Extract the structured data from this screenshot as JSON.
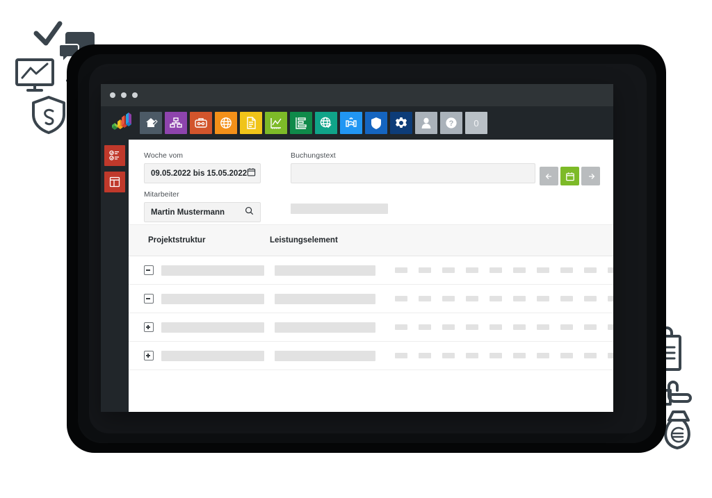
{
  "window": {
    "titlebar": {
      "dots": 3
    },
    "logo_name": "app-logo-colorful-bars"
  },
  "toolbar": {
    "tiles": [
      {
        "name": "home-icon",
        "label": "Home",
        "color": "#4c5a66"
      },
      {
        "name": "org-structure-icon",
        "label": "Organisation",
        "color": "#8e44ad"
      },
      {
        "name": "briefcase-icon",
        "label": "Projekte",
        "color": "#d2552c"
      },
      {
        "name": "globe-icon",
        "label": "Web",
        "color": "#f39019"
      },
      {
        "name": "document-icon",
        "label": "Dokumente",
        "color": "#f0c419"
      },
      {
        "name": "line-chart-icon",
        "label": "Auswertung",
        "color": "#7dba28"
      },
      {
        "name": "gantt-chart-icon",
        "label": "Planung",
        "color": "#0f8a4a"
      },
      {
        "name": "globe-check-icon",
        "label": "Portal",
        "color": "#10a489"
      },
      {
        "name": "handshake-icon",
        "label": "Service",
        "color": "#2196f3"
      },
      {
        "name": "shield-icon",
        "label": "Sicherheit",
        "color": "#1565c0"
      },
      {
        "name": "gear-icon",
        "label": "Einstellungen",
        "color": "#0d3c78"
      },
      {
        "name": "user-icon",
        "label": "Benutzer",
        "color": "#aab2ba"
      },
      {
        "name": "help-icon",
        "label": "Hilfe",
        "color": "#aab2ba"
      },
      {
        "name": "notification-count",
        "label": "0",
        "color": "#b9c0c6"
      }
    ]
  },
  "sidebar": {
    "items": [
      {
        "name": "sidebar-item-tasklist",
        "label": "Aufgabenliste",
        "color": "#c0392b"
      },
      {
        "name": "sidebar-item-layout",
        "label": "Ansicht",
        "color": "#c0392b"
      }
    ]
  },
  "form": {
    "week": {
      "label": "Woche vom",
      "value": "09.05.2022 bis 15.05.2022",
      "icon": "calendar-icon"
    },
    "employee": {
      "label": "Mitarbeiter",
      "value": "Martin Mustermann",
      "icon": "search-icon"
    },
    "booking_text": {
      "label": "Buchungstext",
      "value": "",
      "placeholder": ""
    },
    "nav_buttons": [
      {
        "name": "previous-week-button",
        "icon": "arrow-left-icon",
        "color": "#b9bcbe"
      },
      {
        "name": "today-button",
        "icon": "calendar-icon",
        "color": "#7dba28"
      },
      {
        "name": "next-week-button",
        "icon": "arrow-right-icon",
        "color": "#b9bcbe"
      }
    ]
  },
  "table": {
    "columns": [
      {
        "name": "column-projektstruktur",
        "label": "Projektstruktur"
      },
      {
        "name": "column-leistungselement",
        "label": "Leistungselement"
      }
    ],
    "day_cells_per_row": 10,
    "rows": [
      {
        "expander": "minus",
        "state": "expanded"
      },
      {
        "expander": "minus",
        "state": "expanded"
      },
      {
        "expander": "plus",
        "state": "collapsed"
      },
      {
        "expander": "plus",
        "state": "collapsed"
      }
    ]
  },
  "decorations": {
    "icons": [
      "checkmark-icon",
      "chat-bubbles-icon",
      "monitor-chart-icon",
      "factory-icon",
      "clock-history-icon",
      "shield-paragraph-icon",
      "building-icon",
      "loading-circle-icon",
      "org-chart-icon",
      "clipboard-lock-icon",
      "bank-icon",
      "calendar-icon",
      "pointing-hand-icon",
      "currency-coins-icon",
      "money-bag-euro-icon",
      "crane-icon",
      "worker-icon",
      "chart-arrow-icon"
    ],
    "color": "#3a444c"
  },
  "theme": {
    "titlebar": "#2f3437",
    "toolbar": "#21262a",
    "accent_green": "#7dba28",
    "sidebar_red": "#c0392b",
    "skeleton": "#e2e2e2"
  }
}
